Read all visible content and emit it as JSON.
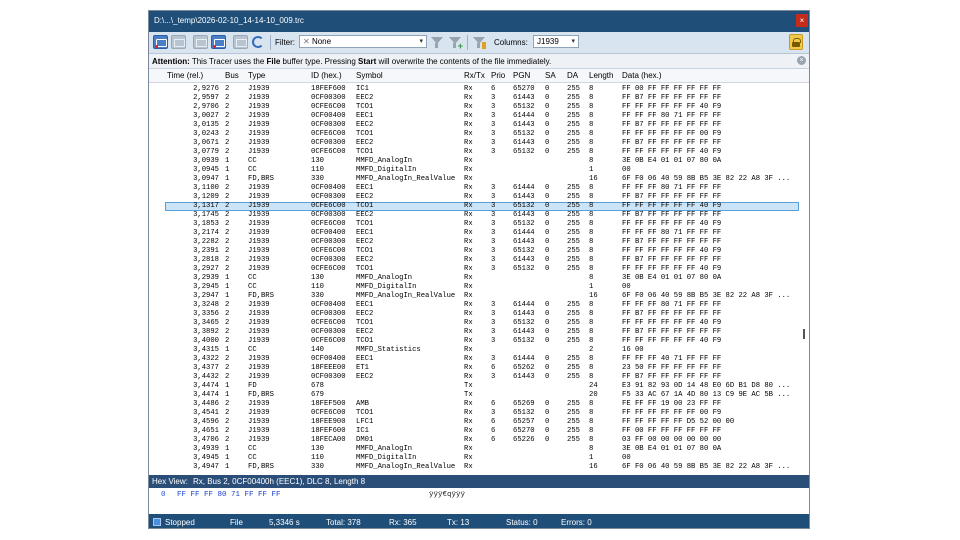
{
  "window": {
    "title": "D:\\...\\_temp\\2026-02-10_14-14-10_009.trc",
    "close_glyph": "×"
  },
  "toolbar": {
    "filter_label": "Filter:",
    "filter_value": "None",
    "filter_clear_glyph": "✕",
    "columns_label": "Columns:",
    "columns_value": "J1939",
    "dropdown_glyph": "▾"
  },
  "infobar": {
    "prefix": "Attention:",
    "text1": " This Tracer uses the ",
    "bold_file": "File",
    "text2": " buffer type. Pressing ",
    "bold_start": "Start",
    "text3": " will overwrite the contents of the file immediately.",
    "close_glyph": "×"
  },
  "columns": [
    "Time (rel.)",
    "Bus",
    "Type",
    "ID (hex.)",
    "Symbol",
    "Rx/Tx",
    "Prio",
    "PGN",
    "SA",
    "DA",
    "Length",
    "Data (hex.)"
  ],
  "selected_row_index": 13,
  "rows": [
    [
      "2,9276",
      "2",
      "J1939",
      "18FEF600",
      "IC1",
      "Rx",
      "6",
      "65270",
      "0",
      "255",
      "8",
      "FF 00 FF FF FF FF FF FF"
    ],
    [
      "2,9597",
      "2",
      "J1939",
      "0CF00300",
      "EEC2",
      "Rx",
      "3",
      "61443",
      "0",
      "255",
      "8",
      "FF B7 FF FF FF FF FF FF"
    ],
    [
      "2,9706",
      "2",
      "J1939",
      "0CFE6C00",
      "TCO1",
      "Rx",
      "3",
      "65132",
      "0",
      "255",
      "8",
      "FF FF FF FF FF FF 40 F9"
    ],
    [
      "3,0027",
      "2",
      "J1939",
      "0CF00400",
      "EEC1",
      "Rx",
      "3",
      "61444",
      "0",
      "255",
      "8",
      "FF FF FF 80 71 FF FF FF"
    ],
    [
      "3,0135",
      "2",
      "J1939",
      "0CF00300",
      "EEC2",
      "Rx",
      "3",
      "61443",
      "0",
      "255",
      "8",
      "FF B7 FF FF FF FF FF FF"
    ],
    [
      "3,0243",
      "2",
      "J1939",
      "0CFE6C00",
      "TCO1",
      "Rx",
      "3",
      "65132",
      "0",
      "255",
      "8",
      "FF FF FF FF FF FF 00 F9"
    ],
    [
      "3,0671",
      "2",
      "J1939",
      "0CF00300",
      "EEC2",
      "Rx",
      "3",
      "61443",
      "0",
      "255",
      "8",
      "FF B7 FF FF FF FF FF FF"
    ],
    [
      "3,0779",
      "2",
      "J1939",
      "0CFE6C00",
      "TCO1",
      "Rx",
      "3",
      "65132",
      "0",
      "255",
      "8",
      "FF FF FF FF FF FF 40 F9"
    ],
    [
      "3,0939",
      "1",
      "CC",
      "130",
      "MMFD_AnalogIn",
      "Rx",
      "",
      "",
      "",
      "",
      "8",
      "3E 0B E4 01 01 07 80 0A"
    ],
    [
      "3,0945",
      "1",
      "CC",
      "110",
      "MMFD_DigitalIn",
      "Rx",
      "",
      "",
      "",
      "",
      "1",
      "00"
    ],
    [
      "3,0947",
      "1",
      "FD,BRS",
      "330",
      "MMFD_AnalogIn_RealValue",
      "Rx",
      "",
      "",
      "",
      "",
      "16",
      "6F F0 06 40 59 8B B5 3E 82 22 A8 3F ..."
    ],
    [
      "3,1100",
      "2",
      "J1939",
      "0CF00400",
      "EEC1",
      "Rx",
      "3",
      "61444",
      "0",
      "255",
      "8",
      "FF FF FF 80 71 FF FF FF"
    ],
    [
      "3,1209",
      "2",
      "J1939",
      "0CF00300",
      "EEC2",
      "Rx",
      "3",
      "61443",
      "0",
      "255",
      "8",
      "FF B7 FF FF FF FF FF FF"
    ],
    [
      "3,1317",
      "2",
      "J1939",
      "0CFE6C00",
      "TCO1",
      "Rx",
      "3",
      "65132",
      "0",
      "255",
      "8",
      "FF FF FF FF FF FF 40 F9"
    ],
    [
      "3,1745",
      "2",
      "J1939",
      "0CF00300",
      "EEC2",
      "Rx",
      "3",
      "61443",
      "0",
      "255",
      "8",
      "FF B7 FF FF FF FF FF FF"
    ],
    [
      "3,1853",
      "2",
      "J1939",
      "0CFE6C00",
      "TCO1",
      "Rx",
      "3",
      "65132",
      "0",
      "255",
      "8",
      "FF FF FF FF FF FF 40 F9"
    ],
    [
      "3,2174",
      "2",
      "J1939",
      "0CF00400",
      "EEC1",
      "Rx",
      "3",
      "61444",
      "0",
      "255",
      "8",
      "FF FF FF 80 71 FF FF FF"
    ],
    [
      "3,2282",
      "2",
      "J1939",
      "0CF00300",
      "EEC2",
      "Rx",
      "3",
      "61443",
      "0",
      "255",
      "8",
      "FF B7 FF FF FF FF FF FF"
    ],
    [
      "3,2391",
      "2",
      "J1939",
      "0CFE6C00",
      "TCO1",
      "Rx",
      "3",
      "65132",
      "0",
      "255",
      "8",
      "FF FF FF FF FF FF 40 F9"
    ],
    [
      "3,2818",
      "2",
      "J1939",
      "0CF00300",
      "EEC2",
      "Rx",
      "3",
      "61443",
      "0",
      "255",
      "8",
      "FF B7 FF FF FF FF FF FF"
    ],
    [
      "3,2927",
      "2",
      "J1939",
      "0CFE6C00",
      "TCO1",
      "Rx",
      "3",
      "65132",
      "0",
      "255",
      "8",
      "FF FF FF FF FF FF 40 F9"
    ],
    [
      "3,2939",
      "1",
      "CC",
      "130",
      "MMFD_AnalogIn",
      "Rx",
      "",
      "",
      "",
      "",
      "8",
      "3E 0B E4 01 01 07 80 0A"
    ],
    [
      "3,2945",
      "1",
      "CC",
      "110",
      "MMFD_DigitalIn",
      "Rx",
      "",
      "",
      "",
      "",
      "1",
      "00"
    ],
    [
      "3,2947",
      "1",
      "FD,BRS",
      "330",
      "MMFD_AnalogIn_RealValue",
      "Rx",
      "",
      "",
      "",
      "",
      "16",
      "6F F0 06 40 59 8B B5 3E 82 22 A8 3F ..."
    ],
    [
      "3,3248",
      "2",
      "J1939",
      "0CF00400",
      "EEC1",
      "Rx",
      "3",
      "61444",
      "0",
      "255",
      "8",
      "FF FF FF 80 71 FF FF FF"
    ],
    [
      "3,3356",
      "2",
      "J1939",
      "0CF00300",
      "EEC2",
      "Rx",
      "3",
      "61443",
      "0",
      "255",
      "8",
      "FF B7 FF FF FF FF FF FF"
    ],
    [
      "3,3465",
      "2",
      "J1939",
      "0CFE6C00",
      "TCO1",
      "Rx",
      "3",
      "65132",
      "0",
      "255",
      "8",
      "FF FF FF FF FF FF 40 F9"
    ],
    [
      "3,3892",
      "2",
      "J1939",
      "0CF00300",
      "EEC2",
      "Rx",
      "3",
      "61443",
      "0",
      "255",
      "8",
      "FF B7 FF FF FF FF FF FF"
    ],
    [
      "3,4000",
      "2",
      "J1939",
      "0CFE6C00",
      "TCO1",
      "Rx",
      "3",
      "65132",
      "0",
      "255",
      "8",
      "FF FF FF FF FF FF 40 F9"
    ],
    [
      "3,4315",
      "1",
      "CC",
      "140",
      "MMFD_Statistics",
      "Rx",
      "",
      "",
      "",
      "",
      "2",
      "16 00"
    ],
    [
      "3,4322",
      "2",
      "J1939",
      "0CF00400",
      "EEC1",
      "Rx",
      "3",
      "61444",
      "0",
      "255",
      "8",
      "FF FF FF 40 71 FF FF FF"
    ],
    [
      "3,4377",
      "2",
      "J1939",
      "18FEEE00",
      "ET1",
      "Rx",
      "6",
      "65262",
      "0",
      "255",
      "8",
      "23 50 FF FF FF FF FF FF"
    ],
    [
      "3,4432",
      "2",
      "J1939",
      "0CF00300",
      "EEC2",
      "Rx",
      "3",
      "61443",
      "0",
      "255",
      "8",
      "FF B7 FF FF FF FF FF FF"
    ],
    [
      "3,4474",
      "1",
      "FD",
      "678",
      "",
      "Tx",
      "",
      "",
      "",
      "",
      "24",
      "E3 91 82 93 0D 14 48 E0 6D B1 D8 80 ..."
    ],
    [
      "3,4474",
      "1",
      "FD,BRS",
      "679",
      "",
      "Tx",
      "",
      "",
      "",
      "",
      "20",
      "F5 33 AC 67 1A 4D 80 13 C9 9E AC 5B ..."
    ],
    [
      "3,4486",
      "2",
      "J1939",
      "18FEF500",
      "AMB",
      "Rx",
      "6",
      "65269",
      "0",
      "255",
      "8",
      "FE FF FF 19 00 23 FF FF"
    ],
    [
      "3,4541",
      "2",
      "J1939",
      "0CFE6C00",
      "TCO1",
      "Rx",
      "3",
      "65132",
      "0",
      "255",
      "8",
      "FF FF FF FF FF FF 00 F9"
    ],
    [
      "3,4596",
      "2",
      "J1939",
      "18FEE900",
      "LFC1",
      "Rx",
      "6",
      "65257",
      "0",
      "255",
      "8",
      "FF FF FF FF FF D5 52 00 00"
    ],
    [
      "3,4651",
      "2",
      "J1939",
      "18FEF600",
      "IC1",
      "Rx",
      "6",
      "65270",
      "0",
      "255",
      "8",
      "FF 00 FF FF FF FF FF FF"
    ],
    [
      "3,4706",
      "2",
      "J1939",
      "18FECA00",
      "DM01",
      "Rx",
      "6",
      "65226",
      "0",
      "255",
      "8",
      "03 FF 00 00 00 00 00 00"
    ],
    [
      "3,4939",
      "1",
      "CC",
      "130",
      "MMFD_AnalogIn",
      "Rx",
      "",
      "",
      "",
      "",
      "8",
      "3E 0B E4 01 01 07 80 0A"
    ],
    [
      "3,4945",
      "1",
      "CC",
      "110",
      "MMFD_DigitalIn",
      "Rx",
      "",
      "",
      "",
      "",
      "1",
      "00"
    ],
    [
      "3,4947",
      "1",
      "FD,BRS",
      "330",
      "MMFD_AnalogIn_RealValue",
      "Rx",
      "",
      "",
      "",
      "",
      "16",
      "6F F0 06 40 59 8B B5 3E 82 22 A8 3F ..."
    ]
  ],
  "hexview": {
    "label": "Hex View:",
    "description": "Rx, Bus 2, 0CF00400h (EEC1), DLC 8, Length 8",
    "offset": "0",
    "bytes": "FF FF FF 80 71 FF FF FF",
    "ascii": "ÿÿÿ€qÿÿÿ"
  },
  "status": {
    "state": "Stopped",
    "buffer": "File",
    "time": "5,3346 s",
    "total": "Total: 378",
    "rx": "Rx: 365",
    "tx": "Tx: 13",
    "status": "Status: 0",
    "errors": "Errors: 0"
  }
}
